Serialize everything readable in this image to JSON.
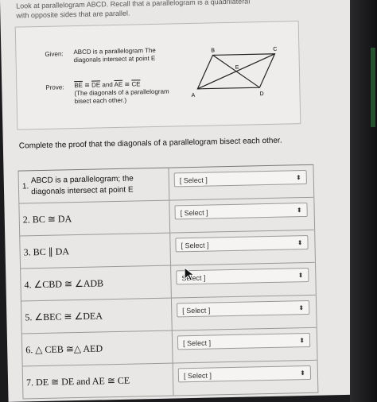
{
  "intro": "Look at parallelogram ABCD. Recall that a parallelogram is a quadrilateral with opposite sides that are parallel.",
  "given": {
    "label": "Given:",
    "text": "ABCD is a parallelogram The diagonals intersect at point E"
  },
  "prove": {
    "label": "Prove:",
    "line1_a": "BE",
    "line1_eq1": " ≅ ",
    "line1_b": "DE",
    "line1_and": " and ",
    "line1_c": "AE",
    "line1_eq2": " ≅ ",
    "line1_d": "CE",
    "line2": "(The diagonals of a parallelogram bisect each other.)"
  },
  "figure": {
    "A": "A",
    "B": "B",
    "C": "C",
    "D": "D",
    "E": "E"
  },
  "instruction": "Complete the proof that the diagonals of a parallelogram bisect each other.",
  "rows": [
    {
      "n": "1.",
      "statement": "ABCD is a parallelogram; the diagonals intersect at point E",
      "select": "[ Select ]"
    },
    {
      "n": "2.",
      "statement": "BC ≅ DA",
      "select": "[ Select ]"
    },
    {
      "n": "3.",
      "statement": "BC ∥ DA",
      "select": "[ Select ]"
    },
    {
      "n": "4.",
      "statement": "∠CBD ≅ ∠ADB",
      "select": "Select ]"
    },
    {
      "n": "5.",
      "statement": "∠BEC ≅ ∠DEA",
      "select": "[ Select ]"
    },
    {
      "n": "6.",
      "statement": "△ CEB ≅△ AED",
      "select": "[ Select ]"
    },
    {
      "n": "7.",
      "statement": "DE ≅ DE and AE ≅ CE",
      "select": "[ Select ]"
    }
  ],
  "colors": {
    "paper": "#e9e7e6",
    "border": "#999999"
  }
}
